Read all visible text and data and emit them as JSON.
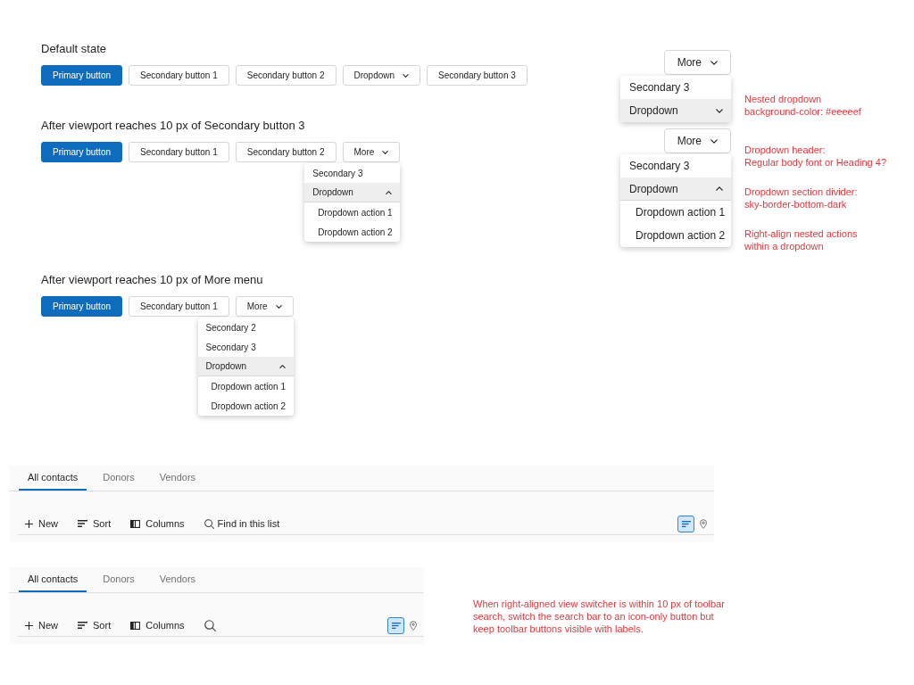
{
  "sections": [
    {
      "heading": "Default state",
      "buttons": [
        {
          "kind": "primary",
          "label": "Primary button"
        },
        {
          "kind": "secondary",
          "label": "Secondary button 1"
        },
        {
          "kind": "secondary",
          "label": "Secondary button 2"
        },
        {
          "kind": "dropdown",
          "label": "Dropdown"
        },
        {
          "kind": "secondary",
          "label": "Secondary button 3"
        }
      ]
    },
    {
      "heading": "After viewport reaches 10 px of Secondary button 3",
      "buttons": [
        {
          "kind": "primary",
          "label": "Primary button"
        },
        {
          "kind": "secondary",
          "label": "Secondary button 1"
        },
        {
          "kind": "secondary",
          "label": "Secondary button 2"
        },
        {
          "kind": "dropdown",
          "label": "More",
          "expanded": true,
          "menu": [
            {
              "kind": "item",
              "label": "Secondary 3"
            },
            {
              "kind": "group",
              "label": "Dropdown",
              "expanded": true,
              "children": [
                {
                  "kind": "item",
                  "label": "Dropdown action 1"
                },
                {
                  "kind": "item",
                  "label": "Dropdown action 2"
                }
              ]
            }
          ]
        }
      ]
    },
    {
      "heading": "After viewport reaches 10 px of More menu",
      "buttons": [
        {
          "kind": "primary",
          "label": "Primary button"
        },
        {
          "kind": "secondary",
          "label": "Secondary button 1"
        },
        {
          "kind": "dropdown",
          "label": "More",
          "expanded": true,
          "menu": [
            {
              "kind": "item",
              "label": "Secondary 2"
            },
            {
              "kind": "item",
              "label": "Secondary 3"
            },
            {
              "kind": "group",
              "label": "Dropdown",
              "expanded": true,
              "children": [
                {
                  "kind": "item",
                  "label": "Dropdown action 1"
                },
                {
                  "kind": "item",
                  "label": "Dropdown action 2"
                }
              ]
            }
          ]
        }
      ]
    }
  ],
  "annotations": [
    {
      "button": {
        "kind": "dropdown",
        "label": "More",
        "expanded": true,
        "menu": [
          {
            "kind": "item",
            "label": "Secondary 3"
          },
          {
            "kind": "group",
            "label": "Dropdown",
            "expanded": false
          }
        ]
      },
      "notes": [
        "Nested dropdown\nbackground-color: #eeeeef"
      ]
    },
    {
      "button": {
        "kind": "dropdown",
        "label": "More",
        "expanded": true,
        "menu": [
          {
            "kind": "item",
            "label": "Secondary 3"
          },
          {
            "kind": "group",
            "label": "Dropdown",
            "expanded": true,
            "children": [
              {
                "kind": "item",
                "label": "Dropdown action 1"
              },
              {
                "kind": "item",
                "label": "Dropdown action 2"
              }
            ]
          }
        ]
      },
      "notes": [
        "Dropdown header:\nRegular body font or Heading 4?",
        "Dropdown section divider:\nsky-border-bottom-dark",
        "Right-align nested actions\nwithin a dropdown"
      ]
    }
  ],
  "toolbars": [
    {
      "tabs": [
        {
          "label": "All contacts",
          "selected": true
        },
        {
          "label": "Donors",
          "selected": false
        },
        {
          "label": "Vendors",
          "selected": false
        }
      ],
      "actions": [
        {
          "kind": "new",
          "label": "New"
        },
        {
          "kind": "sort",
          "label": "Sort"
        },
        {
          "kind": "columns",
          "label": "Columns"
        },
        {
          "kind": "search",
          "placeholder": "Find in this list"
        }
      ],
      "view_switcher": [
        {
          "kind": "list",
          "selected": true
        },
        {
          "kind": "map",
          "selected": false
        }
      ]
    },
    {
      "tabs": [
        {
          "label": "All contacts",
          "selected": true
        },
        {
          "label": "Donors",
          "selected": false
        },
        {
          "label": "Vendors",
          "selected": false
        }
      ],
      "actions": [
        {
          "kind": "new",
          "label": "New"
        },
        {
          "kind": "sort",
          "label": "Sort"
        },
        {
          "kind": "columns",
          "label": "Columns"
        },
        {
          "kind": "search_button"
        }
      ],
      "view_switcher": [
        {
          "kind": "list",
          "selected": true
        },
        {
          "kind": "map",
          "selected": false
        }
      ],
      "note": "When right-aligned view switcher is within 10 px of toolbar\nsearch, switch the search bar to an icon-only button but\nkeep toolbar buttons visible with labels."
    }
  ]
}
